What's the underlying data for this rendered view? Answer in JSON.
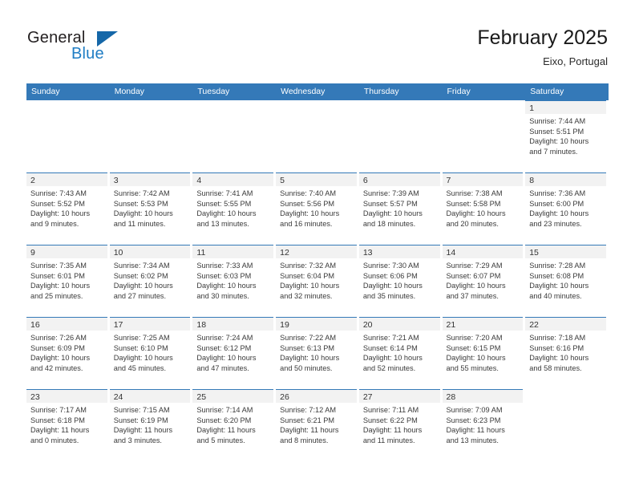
{
  "brand": {
    "name_part1": "General",
    "name_part2": "Blue"
  },
  "header": {
    "title": "February 2025",
    "location": "Eixo, Portugal"
  },
  "colors": {
    "header_blue": "#3479b8",
    "brand_blue": "#1f7dc4",
    "daynum_band": "#f2f2f2",
    "text": "#3a3a3a"
  },
  "calendar": {
    "weekdays": [
      "Sunday",
      "Monday",
      "Tuesday",
      "Wednesday",
      "Thursday",
      "Friday",
      "Saturday"
    ],
    "labels": {
      "sunrise": "Sunrise:",
      "sunset": "Sunset:",
      "daylight": "Daylight:"
    },
    "weeks": [
      [
        {
          "day": "",
          "empty": true
        },
        {
          "day": "",
          "empty": true
        },
        {
          "day": "",
          "empty": true
        },
        {
          "day": "",
          "empty": true
        },
        {
          "day": "",
          "empty": true
        },
        {
          "day": "",
          "empty": true
        },
        {
          "day": "1",
          "sunrise": "Sunrise: 7:44 AM",
          "sunset": "Sunset: 5:51 PM",
          "daylight1": "Daylight: 10 hours",
          "daylight2": "and 7 minutes."
        }
      ],
      [
        {
          "day": "2",
          "sunrise": "Sunrise: 7:43 AM",
          "sunset": "Sunset: 5:52 PM",
          "daylight1": "Daylight: 10 hours",
          "daylight2": "and 9 minutes."
        },
        {
          "day": "3",
          "sunrise": "Sunrise: 7:42 AM",
          "sunset": "Sunset: 5:53 PM",
          "daylight1": "Daylight: 10 hours",
          "daylight2": "and 11 minutes."
        },
        {
          "day": "4",
          "sunrise": "Sunrise: 7:41 AM",
          "sunset": "Sunset: 5:55 PM",
          "daylight1": "Daylight: 10 hours",
          "daylight2": "and 13 minutes."
        },
        {
          "day": "5",
          "sunrise": "Sunrise: 7:40 AM",
          "sunset": "Sunset: 5:56 PM",
          "daylight1": "Daylight: 10 hours",
          "daylight2": "and 16 minutes."
        },
        {
          "day": "6",
          "sunrise": "Sunrise: 7:39 AM",
          "sunset": "Sunset: 5:57 PM",
          "daylight1": "Daylight: 10 hours",
          "daylight2": "and 18 minutes."
        },
        {
          "day": "7",
          "sunrise": "Sunrise: 7:38 AM",
          "sunset": "Sunset: 5:58 PM",
          "daylight1": "Daylight: 10 hours",
          "daylight2": "and 20 minutes."
        },
        {
          "day": "8",
          "sunrise": "Sunrise: 7:36 AM",
          "sunset": "Sunset: 6:00 PM",
          "daylight1": "Daylight: 10 hours",
          "daylight2": "and 23 minutes."
        }
      ],
      [
        {
          "day": "9",
          "sunrise": "Sunrise: 7:35 AM",
          "sunset": "Sunset: 6:01 PM",
          "daylight1": "Daylight: 10 hours",
          "daylight2": "and 25 minutes."
        },
        {
          "day": "10",
          "sunrise": "Sunrise: 7:34 AM",
          "sunset": "Sunset: 6:02 PM",
          "daylight1": "Daylight: 10 hours",
          "daylight2": "and 27 minutes."
        },
        {
          "day": "11",
          "sunrise": "Sunrise: 7:33 AM",
          "sunset": "Sunset: 6:03 PM",
          "daylight1": "Daylight: 10 hours",
          "daylight2": "and 30 minutes."
        },
        {
          "day": "12",
          "sunrise": "Sunrise: 7:32 AM",
          "sunset": "Sunset: 6:04 PM",
          "daylight1": "Daylight: 10 hours",
          "daylight2": "and 32 minutes."
        },
        {
          "day": "13",
          "sunrise": "Sunrise: 7:30 AM",
          "sunset": "Sunset: 6:06 PM",
          "daylight1": "Daylight: 10 hours",
          "daylight2": "and 35 minutes."
        },
        {
          "day": "14",
          "sunrise": "Sunrise: 7:29 AM",
          "sunset": "Sunset: 6:07 PM",
          "daylight1": "Daylight: 10 hours",
          "daylight2": "and 37 minutes."
        },
        {
          "day": "15",
          "sunrise": "Sunrise: 7:28 AM",
          "sunset": "Sunset: 6:08 PM",
          "daylight1": "Daylight: 10 hours",
          "daylight2": "and 40 minutes."
        }
      ],
      [
        {
          "day": "16",
          "sunrise": "Sunrise: 7:26 AM",
          "sunset": "Sunset: 6:09 PM",
          "daylight1": "Daylight: 10 hours",
          "daylight2": "and 42 minutes."
        },
        {
          "day": "17",
          "sunrise": "Sunrise: 7:25 AM",
          "sunset": "Sunset: 6:10 PM",
          "daylight1": "Daylight: 10 hours",
          "daylight2": "and 45 minutes."
        },
        {
          "day": "18",
          "sunrise": "Sunrise: 7:24 AM",
          "sunset": "Sunset: 6:12 PM",
          "daylight1": "Daylight: 10 hours",
          "daylight2": "and 47 minutes."
        },
        {
          "day": "19",
          "sunrise": "Sunrise: 7:22 AM",
          "sunset": "Sunset: 6:13 PM",
          "daylight1": "Daylight: 10 hours",
          "daylight2": "and 50 minutes."
        },
        {
          "day": "20",
          "sunrise": "Sunrise: 7:21 AM",
          "sunset": "Sunset: 6:14 PM",
          "daylight1": "Daylight: 10 hours",
          "daylight2": "and 52 minutes."
        },
        {
          "day": "21",
          "sunrise": "Sunrise: 7:20 AM",
          "sunset": "Sunset: 6:15 PM",
          "daylight1": "Daylight: 10 hours",
          "daylight2": "and 55 minutes."
        },
        {
          "day": "22",
          "sunrise": "Sunrise: 7:18 AM",
          "sunset": "Sunset: 6:16 PM",
          "daylight1": "Daylight: 10 hours",
          "daylight2": "and 58 minutes."
        }
      ],
      [
        {
          "day": "23",
          "sunrise": "Sunrise: 7:17 AM",
          "sunset": "Sunset: 6:18 PM",
          "daylight1": "Daylight: 11 hours",
          "daylight2": "and 0 minutes."
        },
        {
          "day": "24",
          "sunrise": "Sunrise: 7:15 AM",
          "sunset": "Sunset: 6:19 PM",
          "daylight1": "Daylight: 11 hours",
          "daylight2": "and 3 minutes."
        },
        {
          "day": "25",
          "sunrise": "Sunrise: 7:14 AM",
          "sunset": "Sunset: 6:20 PM",
          "daylight1": "Daylight: 11 hours",
          "daylight2": "and 5 minutes."
        },
        {
          "day": "26",
          "sunrise": "Sunrise: 7:12 AM",
          "sunset": "Sunset: 6:21 PM",
          "daylight1": "Daylight: 11 hours",
          "daylight2": "and 8 minutes."
        },
        {
          "day": "27",
          "sunrise": "Sunrise: 7:11 AM",
          "sunset": "Sunset: 6:22 PM",
          "daylight1": "Daylight: 11 hours",
          "daylight2": "and 11 minutes."
        },
        {
          "day": "28",
          "sunrise": "Sunrise: 7:09 AM",
          "sunset": "Sunset: 6:23 PM",
          "daylight1": "Daylight: 11 hours",
          "daylight2": "and 13 minutes."
        },
        {
          "day": "",
          "empty": true
        }
      ]
    ]
  }
}
